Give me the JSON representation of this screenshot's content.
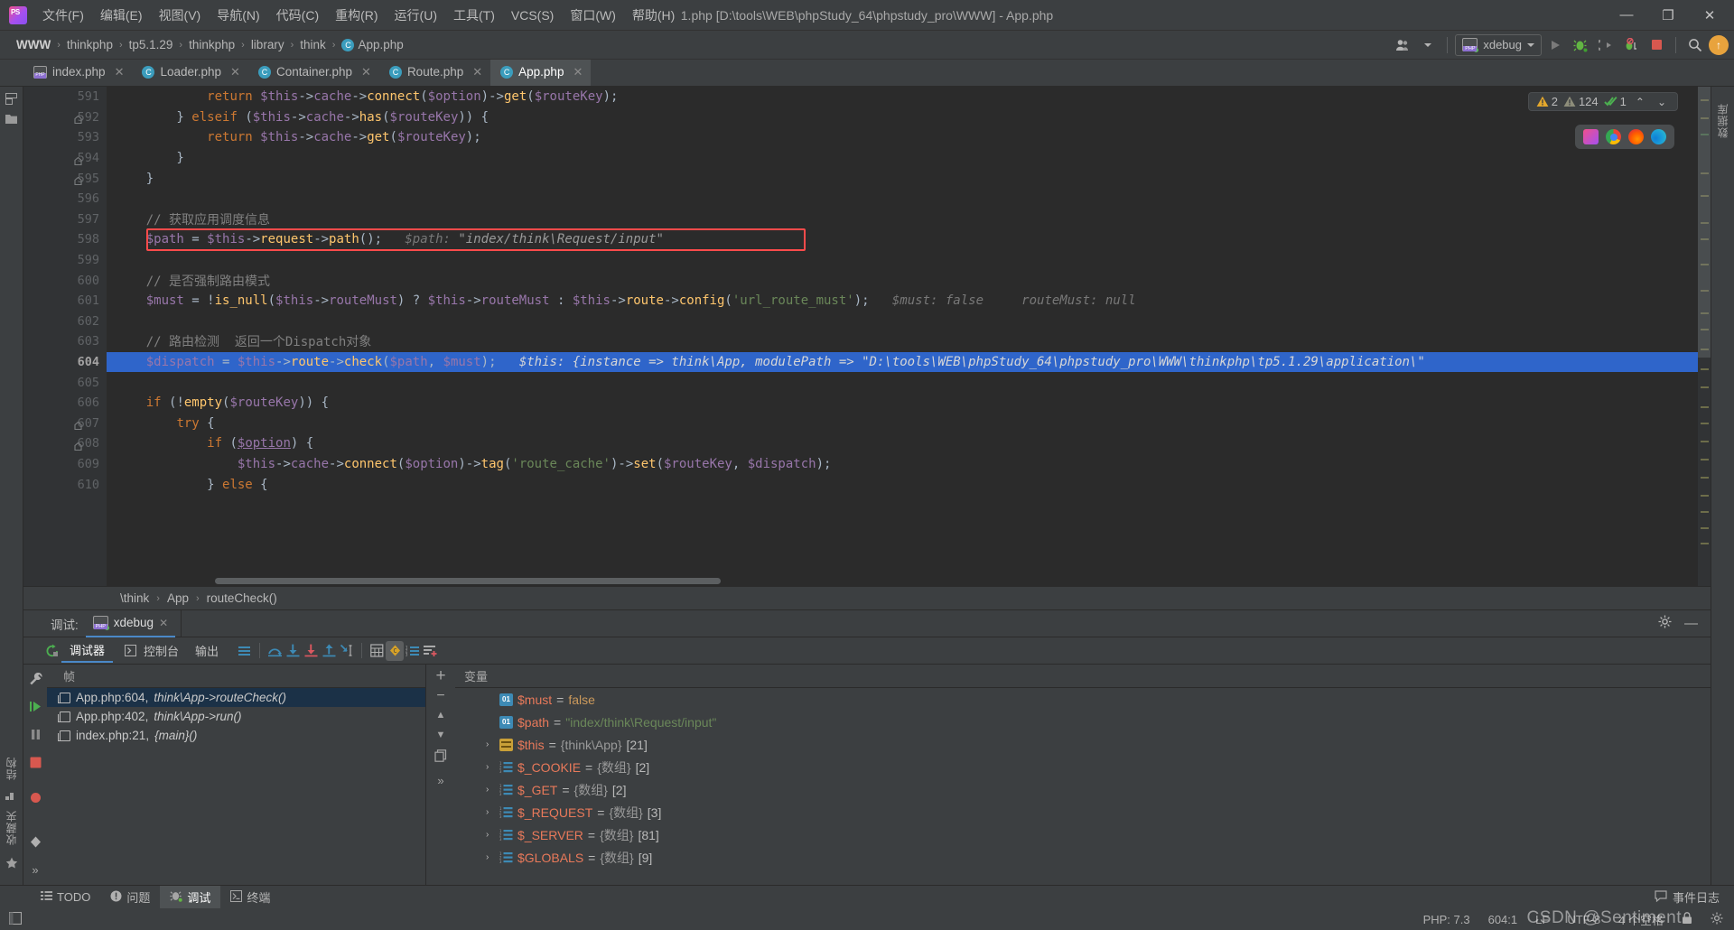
{
  "window": {
    "title": "1.php [D:\\tools\\WEB\\phpStudy_64\\phpstudy_pro\\WWW] - App.php",
    "minimize": "—",
    "maximize": "❐",
    "close": "✕"
  },
  "menu": {
    "items": [
      {
        "label": "文件(F)"
      },
      {
        "label": "编辑(E)"
      },
      {
        "label": "视图(V)"
      },
      {
        "label": "导航(N)"
      },
      {
        "label": "代码(C)"
      },
      {
        "label": "重构(R)"
      },
      {
        "label": "运行(U)"
      },
      {
        "label": "工具(T)"
      },
      {
        "label": "VCS(S)"
      },
      {
        "label": "窗口(W)"
      },
      {
        "label": "帮助(H)"
      }
    ]
  },
  "breadcrumbs": {
    "items": [
      "WWW",
      "thinkphp",
      "tp5.1.29",
      "thinkphp",
      "library",
      "think"
    ],
    "file": "App.php",
    "file_icon_letter": "C",
    "separator": "›"
  },
  "toolbar": {
    "run_config": "xdebug",
    "run_label": "▶",
    "debug_label": "debug",
    "attach_label": "attach",
    "breakpoints_label": "breakpoints",
    "stop_label": "stop",
    "search_label": "search",
    "update_label": "↑",
    "profile_caret": "▾"
  },
  "tabs": [
    {
      "label": "index.php",
      "icon": "php-file-icon",
      "active": false
    },
    {
      "label": "Loader.php",
      "icon": "class-icon",
      "active": false
    },
    {
      "label": "Container.php",
      "icon": "class-icon",
      "active": false
    },
    {
      "label": "Route.php",
      "icon": "class-icon",
      "active": false
    },
    {
      "label": "App.php",
      "icon": "class-icon",
      "active": true
    }
  ],
  "left_strip": {
    "structure_label": "结构",
    "favorites_label": "收藏夹"
  },
  "inspections": {
    "warnings": "2",
    "weak_warnings": "124",
    "oks": "1",
    "up": "⌃",
    "down": "⌄"
  },
  "browsers": [
    "phpstorm-icon",
    "chrome-icon",
    "firefox-icon",
    "edge-icon"
  ],
  "editor": {
    "first_line": 591,
    "current_line": 604,
    "lines": [
      {
        "n": 591,
        "segments": [
          {
            "t": "            ",
            "c": "op"
          },
          {
            "t": "return ",
            "c": "k"
          },
          {
            "t": "$this",
            "c": "var"
          },
          {
            "t": "->",
            "c": "op"
          },
          {
            "t": "cache",
            "c": "var"
          },
          {
            "t": "->",
            "c": "op"
          },
          {
            "t": "connect",
            "c": "fn"
          },
          {
            "t": "(",
            "c": "op"
          },
          {
            "t": "$option",
            "c": "var"
          },
          {
            "t": ")->",
            "c": "op"
          },
          {
            "t": "get",
            "c": "fn"
          },
          {
            "t": "(",
            "c": "op"
          },
          {
            "t": "$routeKey",
            "c": "var"
          },
          {
            "t": ");",
            "c": "op"
          }
        ]
      },
      {
        "n": 592,
        "fold": true,
        "segments": [
          {
            "t": "        } ",
            "c": "op"
          },
          {
            "t": "elseif ",
            "c": "k"
          },
          {
            "t": "(",
            "c": "op"
          },
          {
            "t": "$this",
            "c": "var"
          },
          {
            "t": "->",
            "c": "op"
          },
          {
            "t": "cache",
            "c": "var"
          },
          {
            "t": "->",
            "c": "op"
          },
          {
            "t": "has",
            "c": "fn"
          },
          {
            "t": "(",
            "c": "op"
          },
          {
            "t": "$routeKey",
            "c": "var"
          },
          {
            "t": ")) {",
            "c": "op"
          }
        ]
      },
      {
        "n": 593,
        "segments": [
          {
            "t": "            ",
            "c": "op"
          },
          {
            "t": "return ",
            "c": "k"
          },
          {
            "t": "$this",
            "c": "var"
          },
          {
            "t": "->",
            "c": "op"
          },
          {
            "t": "cache",
            "c": "var"
          },
          {
            "t": "->",
            "c": "op"
          },
          {
            "t": "get",
            "c": "fn"
          },
          {
            "t": "(",
            "c": "op"
          },
          {
            "t": "$routeKey",
            "c": "var"
          },
          {
            "t": ");",
            "c": "op"
          }
        ]
      },
      {
        "n": 594,
        "fold": true,
        "segments": [
          {
            "t": "        }",
            "c": "op"
          }
        ]
      },
      {
        "n": 595,
        "fold": true,
        "segments": [
          {
            "t": "    }",
            "c": "op"
          }
        ]
      },
      {
        "n": 596,
        "segments": []
      },
      {
        "n": 597,
        "segments": [
          {
            "t": "    // 获取应用调度信息",
            "c": "cmt"
          }
        ]
      },
      {
        "n": 598,
        "redbox": true,
        "segments": [
          {
            "t": "    ",
            "c": "op"
          },
          {
            "t": "$path ",
            "c": "var"
          },
          {
            "t": "= ",
            "c": "op"
          },
          {
            "t": "$this",
            "c": "var"
          },
          {
            "t": "->",
            "c": "op"
          },
          {
            "t": "request",
            "c": "fn"
          },
          {
            "t": "->",
            "c": "op"
          },
          {
            "t": "path",
            "c": "fn"
          },
          {
            "t": "();",
            "c": "op"
          },
          {
            "t": "   $path: ",
            "c": "hint"
          },
          {
            "t": "\"index/think\\Request/input\"",
            "c": "hint2"
          }
        ]
      },
      {
        "n": 599,
        "segments": []
      },
      {
        "n": 600,
        "segments": [
          {
            "t": "    // 是否强制路由模式",
            "c": "cmt"
          }
        ]
      },
      {
        "n": 601,
        "segments": [
          {
            "t": "    ",
            "c": "op"
          },
          {
            "t": "$must ",
            "c": "var"
          },
          {
            "t": "= !",
            "c": "op"
          },
          {
            "t": "is_null",
            "c": "fn"
          },
          {
            "t": "(",
            "c": "op"
          },
          {
            "t": "$this",
            "c": "var"
          },
          {
            "t": "->",
            "c": "op"
          },
          {
            "t": "routeMust",
            "c": "var"
          },
          {
            "t": ") ? ",
            "c": "op"
          },
          {
            "t": "$this",
            "c": "var"
          },
          {
            "t": "->",
            "c": "op"
          },
          {
            "t": "routeMust ",
            "c": "var"
          },
          {
            "t": ": ",
            "c": "op"
          },
          {
            "t": "$this",
            "c": "var"
          },
          {
            "t": "->",
            "c": "op"
          },
          {
            "t": "route",
            "c": "fn"
          },
          {
            "t": "->",
            "c": "op"
          },
          {
            "t": "config",
            "c": "fn"
          },
          {
            "t": "(",
            "c": "op"
          },
          {
            "t": "'url_route_must'",
            "c": "str"
          },
          {
            "t": ");",
            "c": "op"
          },
          {
            "t": "   $must: false",
            "c": "hint"
          },
          {
            "t": "     routeMust: null",
            "c": "hint"
          }
        ]
      },
      {
        "n": 602,
        "segments": []
      },
      {
        "n": 603,
        "segments": [
          {
            "t": "    // 路由检测  返回一个Dispatch对象",
            "c": "cmt"
          }
        ]
      },
      {
        "n": 604,
        "selected": true,
        "segments": [
          {
            "t": "    ",
            "c": "op"
          },
          {
            "t": "$dispatch ",
            "c": "var"
          },
          {
            "t": "= ",
            "c": "op"
          },
          {
            "t": "$this",
            "c": "var"
          },
          {
            "t": "->",
            "c": "op"
          },
          {
            "t": "route",
            "c": "fn"
          },
          {
            "t": "->",
            "c": "op"
          },
          {
            "t": "check",
            "c": "fn"
          },
          {
            "t": "(",
            "c": "op"
          },
          {
            "t": "$path",
            "c": "var"
          },
          {
            "t": ", ",
            "c": "op"
          },
          {
            "t": "$must",
            "c": "var"
          },
          {
            "t": ");",
            "c": "op"
          },
          {
            "t": "   $this: {instance => think\\App, modulePath => \"D:\\tools\\WEB\\phpStudy_64\\phpstudy_pro\\WWW\\thinkphp\\tp5.1.29\\application\\\"",
            "c": "sel-hint"
          }
        ]
      },
      {
        "n": 605,
        "segments": []
      },
      {
        "n": 606,
        "segments": [
          {
            "t": "    ",
            "c": "op"
          },
          {
            "t": "if ",
            "c": "k"
          },
          {
            "t": "(!",
            "c": "op"
          },
          {
            "t": "empty",
            "c": "fn"
          },
          {
            "t": "(",
            "c": "op"
          },
          {
            "t": "$routeKey",
            "c": "var"
          },
          {
            "t": ")) {",
            "c": "op"
          }
        ]
      },
      {
        "n": 607,
        "fold": true,
        "segments": [
          {
            "t": "        ",
            "c": "op"
          },
          {
            "t": "try ",
            "c": "k"
          },
          {
            "t": "{",
            "c": "op"
          }
        ]
      },
      {
        "n": 608,
        "fold": true,
        "segments": [
          {
            "t": "            ",
            "c": "op"
          },
          {
            "t": "if ",
            "c": "k"
          },
          {
            "t": "(",
            "c": "op"
          },
          {
            "t": "$option",
            "c": "var underl"
          },
          {
            "t": ") {",
            "c": "op"
          }
        ]
      },
      {
        "n": 609,
        "segments": [
          {
            "t": "                ",
            "c": "op"
          },
          {
            "t": "$this",
            "c": "var"
          },
          {
            "t": "->",
            "c": "op"
          },
          {
            "t": "cache",
            "c": "var"
          },
          {
            "t": "->",
            "c": "op"
          },
          {
            "t": "connect",
            "c": "fn"
          },
          {
            "t": "(",
            "c": "op"
          },
          {
            "t": "$option",
            "c": "var"
          },
          {
            "t": ")->",
            "c": "op"
          },
          {
            "t": "tag",
            "c": "fn"
          },
          {
            "t": "(",
            "c": "op"
          },
          {
            "t": "'route_cache'",
            "c": "str"
          },
          {
            "t": ")->",
            "c": "op"
          },
          {
            "t": "set",
            "c": "fn"
          },
          {
            "t": "(",
            "c": "op"
          },
          {
            "t": "$routeKey",
            "c": "var"
          },
          {
            "t": ", ",
            "c": "op"
          },
          {
            "t": "$dispatch",
            "c": "var"
          },
          {
            "t": ");",
            "c": "op"
          }
        ]
      },
      {
        "n": 610,
        "segments": [
          {
            "t": "            } ",
            "c": "op"
          },
          {
            "t": "else ",
            "c": "k"
          },
          {
            "t": "{",
            "c": "op"
          }
        ]
      }
    ]
  },
  "editor_crumb": {
    "items": [
      "\\think",
      "App",
      "routeCheck()"
    ],
    "separator": "›"
  },
  "debug": {
    "panel_label": "调试:",
    "session_tab": "xdebug",
    "session_close": "✕",
    "settings_icon": "gear-icon",
    "minimize_icon": "minimize-icon",
    "layout_icon": "layout-icon",
    "toolbar": {
      "rerun": "rerun-icon",
      "tabs": [
        {
          "label": "调试器",
          "active": true,
          "icon": null
        },
        {
          "label": "控制台",
          "active": false,
          "icon": "console-icon"
        },
        {
          "label": "输出",
          "active": false,
          "icon": null
        }
      ],
      "actions": [
        "show-execution-point-icon",
        "step-over-icon",
        "step-into-icon",
        "force-step-into-icon",
        "step-out-icon",
        "run-to-cursor-icon",
        "evaluate-expression-icon",
        "mute-breakpoints-icon",
        "settings-list-icon",
        "add-watch-icon"
      ]
    },
    "frames": {
      "header": "帧",
      "rows": [
        {
          "file": "App.php:604,",
          "func": "think\\App->routeCheck()",
          "selected": true
        },
        {
          "file": "App.php:402,",
          "func": "think\\App->run()",
          "selected": false
        },
        {
          "file": "index.php:21,",
          "func": "{main}()",
          "selected": false
        }
      ]
    },
    "variables": {
      "header": "变量",
      "buttons": [
        "+",
        "−",
        "▲",
        "▼",
        "copy-icon",
        "»"
      ],
      "rows": [
        {
          "arrow": "",
          "icon": "01",
          "name": "$must",
          "eq": "=",
          "value": "false",
          "vclass": "v-false",
          "type": "",
          "count": ""
        },
        {
          "arrow": "",
          "icon": "01",
          "name": "$path",
          "eq": "=",
          "value": "\"index/think\\Request/input\"",
          "vclass": "v-str",
          "type": "",
          "count": ""
        },
        {
          "arrow": "›",
          "icon": "obj",
          "name": "$this",
          "eq": "=",
          "value": "",
          "vclass": "",
          "type": "{think\\App}",
          "count": "[21]"
        },
        {
          "arrow": "›",
          "icon": "arr",
          "name": "$_COOKIE",
          "eq": "=",
          "value": "",
          "vclass": "",
          "type": "{数组}",
          "count": "[2]"
        },
        {
          "arrow": "›",
          "icon": "arr",
          "name": "$_GET",
          "eq": "=",
          "value": "",
          "vclass": "",
          "type": "{数组}",
          "count": "[2]"
        },
        {
          "arrow": "›",
          "icon": "arr",
          "name": "$_REQUEST",
          "eq": "=",
          "value": "",
          "vclass": "",
          "type": "{数组}",
          "count": "[3]"
        },
        {
          "arrow": "›",
          "icon": "arr",
          "name": "$_SERVER",
          "eq": "=",
          "value": "",
          "vclass": "",
          "type": "{数组}",
          "count": "[81]"
        },
        {
          "arrow": "›",
          "icon": "arr",
          "name": "$GLOBALS",
          "eq": "=",
          "value": "",
          "vclass": "",
          "type": "{数组}",
          "count": "[9]"
        }
      ]
    }
  },
  "tool_windows": {
    "items": [
      {
        "label": "TODO",
        "icon": "todo-icon",
        "active": false
      },
      {
        "label": "问题",
        "icon": "problems-icon",
        "active": false
      },
      {
        "label": "调试",
        "icon": "debug-bug-icon",
        "active": true
      },
      {
        "label": "终端",
        "icon": "terminal-icon",
        "active": false
      }
    ],
    "event_log": "事件日志"
  },
  "statusbar": {
    "php_version": "PHP: 7.3",
    "caret": "604:1",
    "line_sep": "LF",
    "encoding": "UTF-8",
    "indent": "4 个空格",
    "lock_icon": "lock-icon",
    "settings_icon": "gear-icon"
  },
  "watermark": "CSDN @Sentiment",
  "colors": {
    "chrome_bg": "#3c3f41",
    "editor_bg": "#2b2b2b",
    "gutter_bg": "#313335",
    "accent_blue": "#4a88c7",
    "selection_blue": "#2f65ca",
    "redbox": "#ff4b4b",
    "string_green": "#6a8759",
    "keyword_orange": "#cc7832",
    "var_purple": "#9876aa",
    "fn_yellow": "#ffc66d"
  }
}
